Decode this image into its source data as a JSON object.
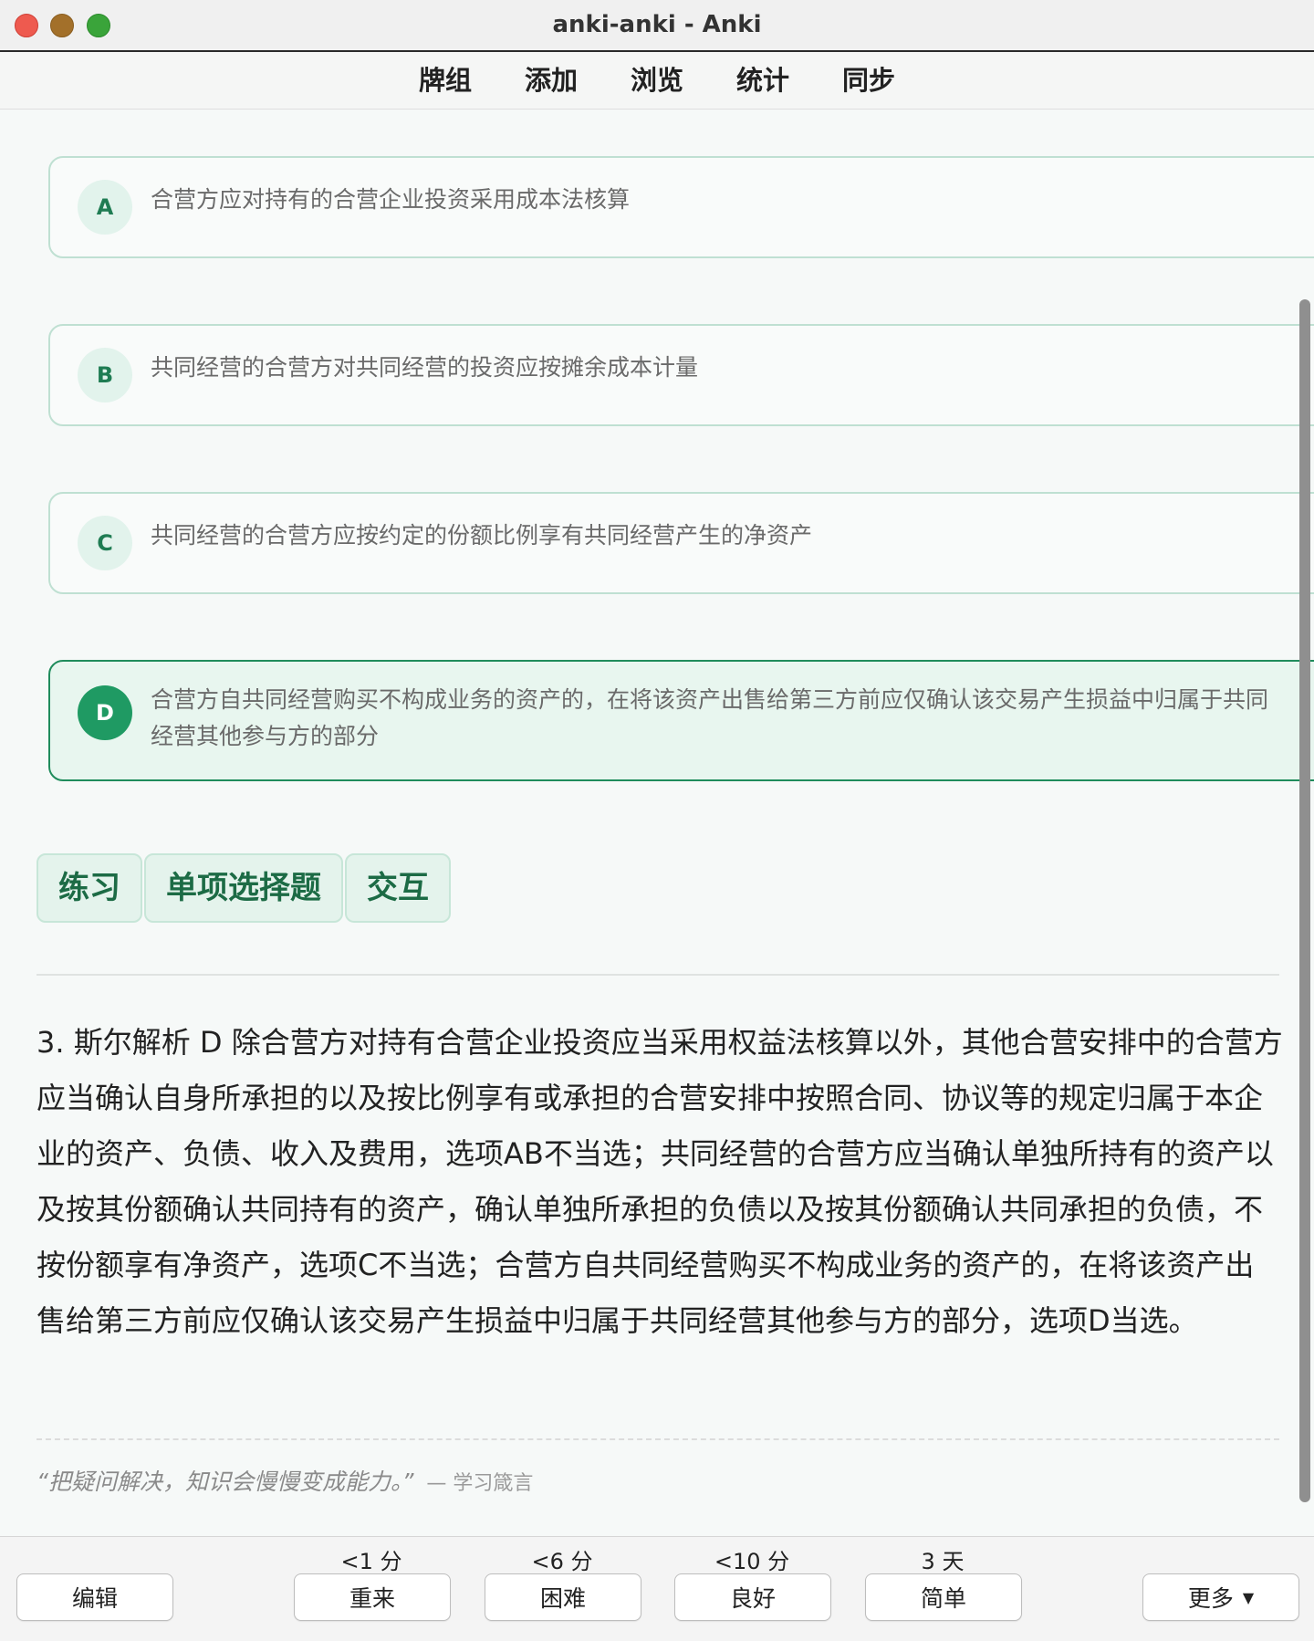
{
  "window": {
    "title": "anki-anki - Anki"
  },
  "nav": [
    "牌组",
    "添加",
    "浏览",
    "统计",
    "同步"
  ],
  "options": [
    {
      "letter": "A",
      "text": "合营方应对持有的合营企业投资采用成本法核算",
      "correct": false
    },
    {
      "letter": "B",
      "text": "共同经营的合营方对共同经营的投资应按摊余成本计量",
      "correct": false
    },
    {
      "letter": "C",
      "text": "共同经营的合营方应按约定的份额比例享有共同经营产生的净资产",
      "correct": false
    },
    {
      "letter": "D",
      "text_line1": "合营方自共同经营购买不构成业务的资产的，在将该资产出售给第三方前应仅确认该交易产生损益中归属于共同",
      "text_line2": "经营其他参与方的部分",
      "correct": true
    }
  ],
  "tags": [
    "练习",
    "单项选择题",
    "交互"
  ],
  "explanation": "3. 斯尔解析 D 除合营方对持有合营企业投资应当采用权益法核算以外，其他合营安排中的合营方应当确认自身所承担的以及按比例享有或承担的合营安排中按照合同、协议等的规定归属于本企业的资产、负债、收入及费用，选项AB不当选；共同经营的合营方应当确认单独所持有的资产以及按其份额确认共同持有的资产，确认单独所承担的负债以及按其份额确认共同承担的负债，不按份额享有净资产，选项C不当选；合营方自共同经营购买不构成业务的资产的，在将该资产出售给第三方前应仅确认该交易产生损益中归属于共同经营其他参与方的部分，选项D当选。",
  "quote": {
    "text": "“把疑问解决，知识会慢慢变成能力。”",
    "source": "— 学习箴言"
  },
  "bottom": {
    "edit": "编辑",
    "more": "更多",
    "ease": [
      {
        "time": "<1 分",
        "label": "重来"
      },
      {
        "time": "<6 分",
        "label": "困难"
      },
      {
        "time": "<10 分",
        "label": "良好"
      },
      {
        "time": "3 天",
        "label": "简单"
      }
    ]
  }
}
